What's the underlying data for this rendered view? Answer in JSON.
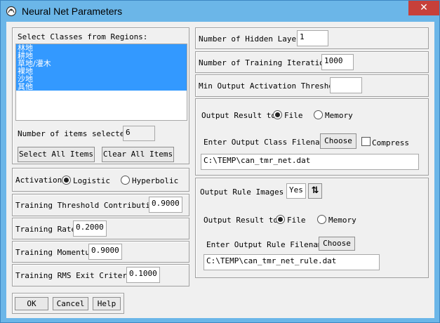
{
  "window": {
    "title": "Neural Net Parameters",
    "close_glyph": "✕"
  },
  "classes": {
    "heading": "Select Classes from Regions:",
    "items": [
      "林地",
      "耕地",
      "草地/灌木",
      "裸地",
      "沙地",
      "其他"
    ],
    "count_label": "Number of items selected:",
    "count_value": "6",
    "select_all_label": "Select All Items",
    "clear_all_label": "Clear All Items"
  },
  "activation": {
    "label": "Activation",
    "options": [
      "Logistic",
      "Hyperbolic"
    ],
    "selected": "Logistic"
  },
  "params": {
    "threshold_label": "Training Threshold Contribution",
    "threshold_value": "0.9000",
    "rate_label": "Training Rate",
    "rate_value": "0.2000",
    "momentum_label": "Training Momentum",
    "momentum_value": "0.9000",
    "rms_label": "Training RMS Exit Criteria",
    "rms_value": "0.1000"
  },
  "footer": {
    "ok_label": "OK",
    "cancel_label": "Cancel",
    "help_label": "Help"
  },
  "network": {
    "hidden_layers_label": "Number of Hidden Layers",
    "hidden_layers_value": "1",
    "iterations_label": "Number of Training Iterations",
    "iterations_value": "1000",
    "min_threshold_label": "Min Output Activation Threshold",
    "min_threshold_value": ""
  },
  "output_class": {
    "result_label": "Output Result to",
    "file_label": "File",
    "memory_label": "Memory",
    "selected": "File",
    "filename_label": "Enter Output Class Filename",
    "choose_label": "Choose",
    "compress_label": "Compress",
    "compress_checked": false,
    "filename_value": "C:\\TEMP\\can_tmr_net.dat"
  },
  "output_rule": {
    "images_label": "Output Rule Images ?",
    "images_value": "Yes",
    "toggle_glyph": "⇅",
    "result_label": "Output Result to",
    "file_label": "File",
    "memory_label": "Memory",
    "selected": "File",
    "filename_label": "Enter Output Rule Filename",
    "choose_label": "Choose",
    "filename_value": "C:\\TEMP\\can_tmr_net_rule.dat"
  },
  "colors": {
    "titlebar": "#6bb6e8",
    "close_button": "#c7403a",
    "selection": "#3399ff",
    "dialog_bg": "#f0f0f0"
  }
}
